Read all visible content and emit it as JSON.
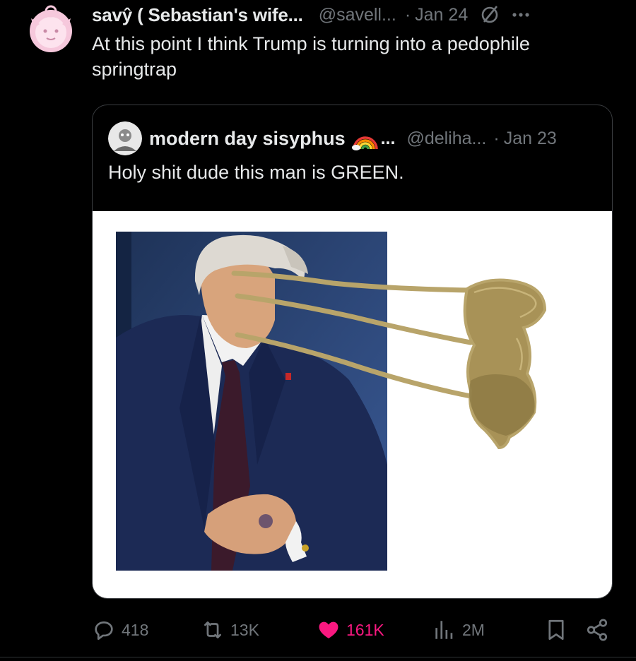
{
  "tweet": {
    "author_name": "savŷ ( Sebastian's wife...",
    "author_handle": "@savell...",
    "separator": "·",
    "date": "Jan 24",
    "text": "At this point I think Trump is turning into a pedophile springtrap",
    "badge_icon": "slashed-circle-icon",
    "more_icon": "more-options-icon"
  },
  "quote": {
    "author_name": "modern day sisyphus",
    "name_emoji": "rainbow-icon",
    "ellipsis": "...",
    "author_handle": "@deliha...",
    "separator": "·",
    "date": "Jan 23",
    "text": "Holy shit dude this man is GREEN."
  },
  "actions": {
    "replies": "418",
    "reposts": "13K",
    "likes": "161K",
    "views": "2M"
  },
  "colors": {
    "background": "#000000",
    "text": "#e7e9ea",
    "muted": "#71767b",
    "like": "#f91880",
    "scribble_gold": "#b8a46a"
  }
}
